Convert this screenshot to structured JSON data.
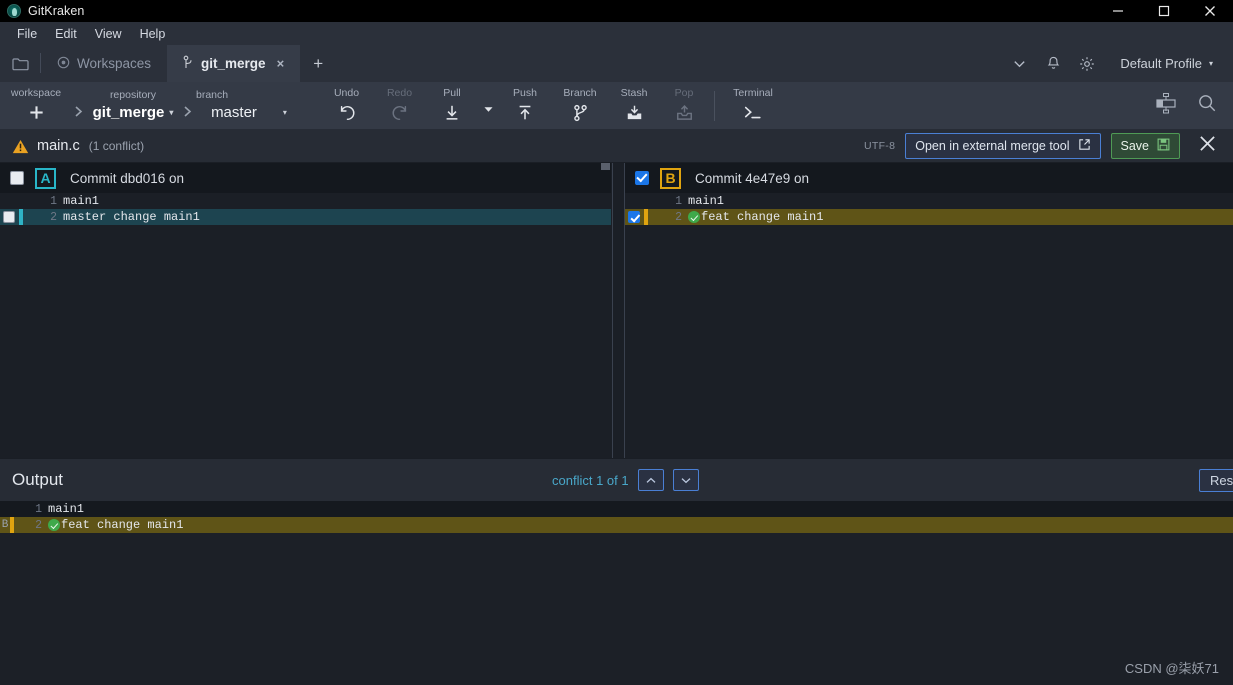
{
  "window": {
    "title": "GitKraken",
    "icon": "gitkraken-logo-icon",
    "controls": {
      "minimize": "minimize-icon",
      "maximize": "maximize-icon",
      "close": "close-icon"
    }
  },
  "menubar": {
    "items": [
      "File",
      "Edit",
      "View",
      "Help"
    ]
  },
  "tabbar": {
    "folder_icon": "folder-icon",
    "tabs": [
      {
        "label": "Workspaces",
        "icon": "workspaces-icon",
        "active": false,
        "closable": false
      },
      {
        "label": "git_merge",
        "icon": "branch-icon",
        "active": true,
        "closable": true,
        "close": "×"
      }
    ],
    "new_tab": "+",
    "chevron": "chevron-down-icon",
    "bell": "bell-icon",
    "gear": "gear-icon",
    "profile": "Default Profile",
    "profile_caret": "▾"
  },
  "toolbar": {
    "workspace_label": "workspace",
    "workspace_add": "+",
    "repository_label": "repository",
    "repository_value": "git_merge",
    "branch_label": "branch",
    "branch_value": "master",
    "actions": [
      {
        "label": "Undo",
        "icon": "undo-icon",
        "enabled": true
      },
      {
        "label": "Redo",
        "icon": "redo-icon",
        "enabled": false
      },
      {
        "label": "Pull",
        "icon": "pull-icon",
        "enabled": true
      },
      {
        "label": "Push",
        "icon": "push-icon",
        "enabled": true
      },
      {
        "label": "Branch",
        "icon": "branch-icon",
        "enabled": true
      },
      {
        "label": "Stash",
        "icon": "stash-icon",
        "enabled": true
      },
      {
        "label": "Pop",
        "icon": "pop-icon",
        "enabled": false
      },
      {
        "label": "Terminal",
        "icon": "terminal-icon",
        "enabled": true
      }
    ],
    "right_icons": [
      "layout-toggle-icon",
      "search-icon"
    ]
  },
  "conflict_header": {
    "warning_icon": "warning-triangle-icon",
    "file_name": "main.c",
    "conflict_count": "(1 conflict)",
    "encoding": "UTF-8",
    "external_tool_button": "Open in external merge tool",
    "external_tool_icon": "external-link-icon",
    "save_button": "Save",
    "save_icon": "save-disk-icon",
    "close_icon": "close-icon"
  },
  "panes": {
    "left": {
      "side_letter": "A",
      "title": "Commit dbd016 on",
      "checked": false,
      "accent": "#29b6c8",
      "lines": [
        {
          "no": "1",
          "text": "main1",
          "conflict": false,
          "checked": null
        },
        {
          "no": "2",
          "text": "master change main1",
          "conflict": true,
          "checked": false
        }
      ]
    },
    "right": {
      "side_letter": "B",
      "title": "Commit 4e47e9 on",
      "checked": true,
      "accent": "#e0a410",
      "lines": [
        {
          "no": "1",
          "text": "main1",
          "conflict": false,
          "checked": null
        },
        {
          "no": "2",
          "text": "feat change main1",
          "conflict": true,
          "checked": true,
          "status_icon": "check-circle-icon"
        }
      ]
    }
  },
  "output": {
    "title": "Output",
    "conflict_status": "conflict 1 of 1",
    "nav_prev_icon": "chevron-up-icon",
    "nav_next_icon": "chevron-down-icon",
    "reset_button": "Reset",
    "lines": [
      {
        "gutter": "",
        "no": "1",
        "text": "main1",
        "conflict": false
      },
      {
        "gutter": "B",
        "no": "2",
        "text": "feat change main1",
        "conflict": true,
        "status_icon": "check-circle-icon"
      }
    ]
  },
  "watermark": "CSDN @柒妖71"
}
